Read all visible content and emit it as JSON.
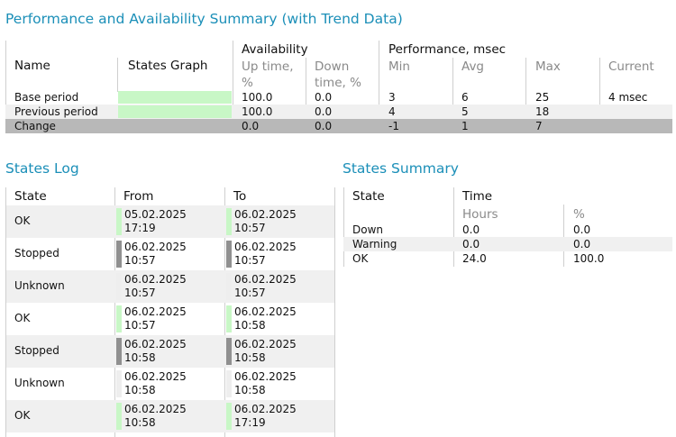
{
  "colors": {
    "title": "#1b8fb8",
    "ok": "#c8f7c6",
    "stopped": "#909090",
    "unknown": "#eeeeee",
    "alt_row": "#f0f0f0",
    "change_row": "#b8b8b8"
  },
  "perf": {
    "title": "Performance and Availability Summary (with Trend Data)",
    "group_availability": "Availability",
    "group_performance": "Performance, msec",
    "col_name": "Name",
    "col_graph": "States Graph",
    "col_uptime": "Up time, %",
    "col_downtime": "Down time, %",
    "col_min": "Min",
    "col_avg": "Avg",
    "col_max": "Max",
    "col_current": "Current",
    "rows": [
      {
        "name": "Base period",
        "up": "100.0",
        "down": "0.0",
        "min": "3",
        "avg": "6",
        "max": "25",
        "current": "4 msec",
        "ok_fraction": 1.0
      },
      {
        "name": "Previous period",
        "up": "100.0",
        "down": "0.0",
        "min": "4",
        "avg": "5",
        "max": "18",
        "current": "",
        "ok_fraction": 1.0
      },
      {
        "name": "Change",
        "up": "0.0",
        "down": "0.0",
        "min": "-1",
        "avg": "1",
        "max": "7",
        "current": ""
      }
    ]
  },
  "log": {
    "title": "States Log",
    "col_state": "State",
    "col_from": "From",
    "col_to": "To",
    "rows": [
      {
        "state": "OK",
        "from_date": "05.02.2025",
        "from_time": "17:19",
        "to_date": "06.02.2025",
        "to_time": "10:57",
        "kind": "ok"
      },
      {
        "state": "Stopped",
        "from_date": "06.02.2025",
        "from_time": "10:57",
        "to_date": "06.02.2025",
        "to_time": "10:57",
        "kind": "stopped"
      },
      {
        "state": "Unknown",
        "from_date": "06.02.2025",
        "from_time": "10:57",
        "to_date": "06.02.2025",
        "to_time": "10:57",
        "kind": "unknown"
      },
      {
        "state": "OK",
        "from_date": "06.02.2025",
        "from_time": "10:57",
        "to_date": "06.02.2025",
        "to_time": "10:58",
        "kind": "ok"
      },
      {
        "state": "Stopped",
        "from_date": "06.02.2025",
        "from_time": "10:58",
        "to_date": "06.02.2025",
        "to_time": "10:58",
        "kind": "stopped"
      },
      {
        "state": "Unknown",
        "from_date": "06.02.2025",
        "from_time": "10:58",
        "to_date": "06.02.2025",
        "to_time": "10:58",
        "kind": "unknown"
      },
      {
        "state": "OK",
        "from_date": "06.02.2025",
        "from_time": "10:58",
        "to_date": "06.02.2025",
        "to_time": "17:19",
        "kind": "ok"
      }
    ]
  },
  "summary": {
    "title": "States Summary",
    "col_state": "State",
    "col_time": "Time",
    "sub_hours": "Hours",
    "sub_pct": "%",
    "rows": [
      {
        "state": "Down",
        "hours": "0.0",
        "pct": "0.0"
      },
      {
        "state": "Warning",
        "hours": "0.0",
        "pct": "0.0"
      },
      {
        "state": "OK",
        "hours": "24.0",
        "pct": "100.0"
      }
    ]
  }
}
